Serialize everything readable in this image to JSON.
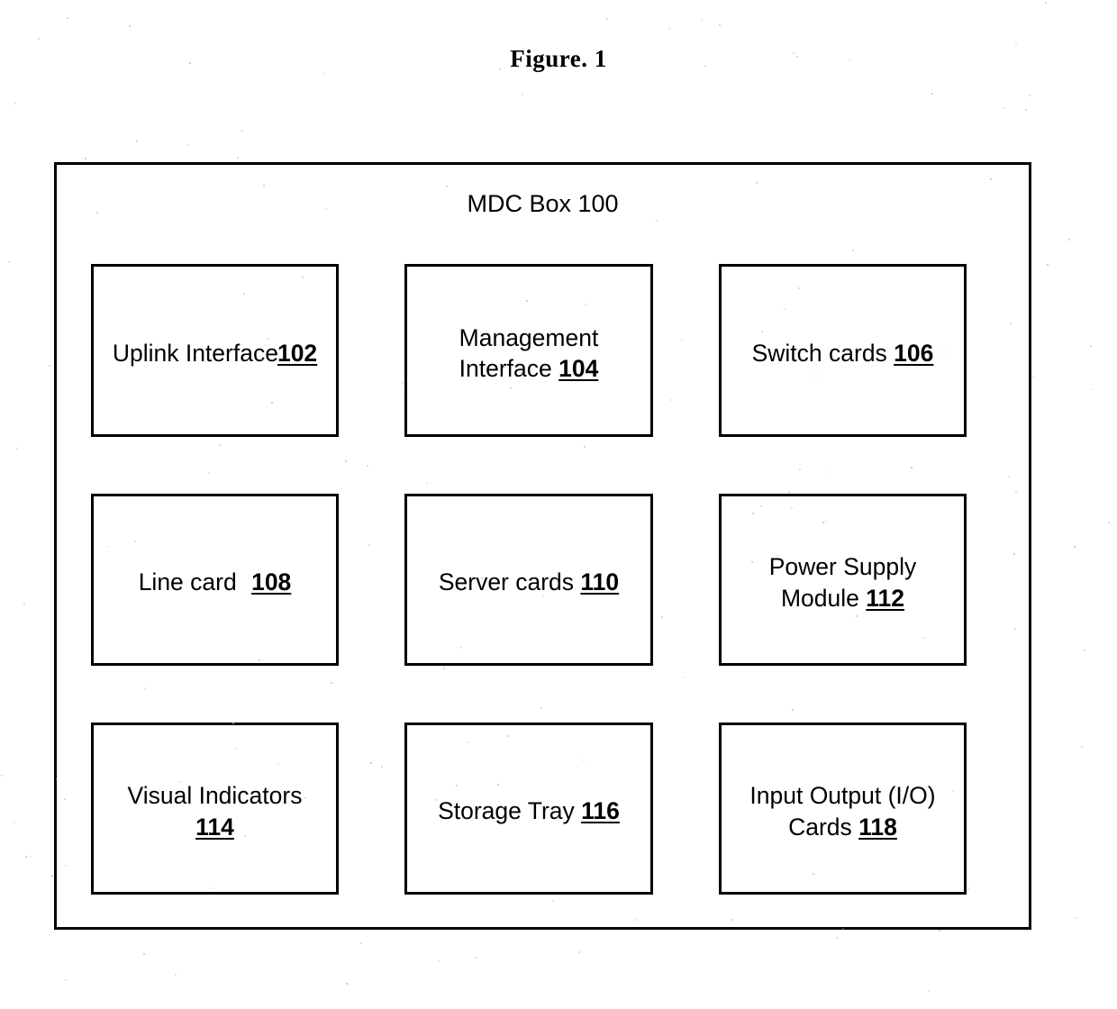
{
  "figure": {
    "caption": "Figure. 1"
  },
  "enclosure": {
    "title": "MDC Box 100",
    "name": "MDC Box",
    "ref": "100"
  },
  "components": [
    {
      "label": "Uplink Interface",
      "ref": "102",
      "name": "uplink-interface",
      "join": "none",
      "lines": 1
    },
    {
      "label": "Management\nInterface ",
      "ref": "104",
      "name": "management-interface",
      "join": "tight",
      "lines": 2
    },
    {
      "label": "Switch cards ",
      "ref": "106",
      "name": "switch-cards",
      "join": "tight",
      "lines": 1
    },
    {
      "label": "Line card ",
      "ref": "108",
      "name": "line-card",
      "join": "wide",
      "lines": 1
    },
    {
      "label": "Server cards ",
      "ref": "110",
      "name": "server-cards",
      "join": "tight",
      "lines": 1
    },
    {
      "label": "Power Supply\nModule ",
      "ref": "112",
      "name": "power-supply-module",
      "join": "tight",
      "lines": 2
    },
    {
      "label": "Visual Indicators\n",
      "ref": "114",
      "name": "visual-indicators",
      "join": "tight",
      "lines": 2
    },
    {
      "label": "Storage Tray ",
      "ref": "116",
      "name": "storage-tray",
      "join": "tight",
      "lines": 1
    },
    {
      "label": "Input Output (I/O)\nCards ",
      "ref": "118",
      "name": "io-cards",
      "join": "tight",
      "lines": 2
    }
  ],
  "colors": {
    "ink": "#000000",
    "paper": "#ffffff"
  }
}
